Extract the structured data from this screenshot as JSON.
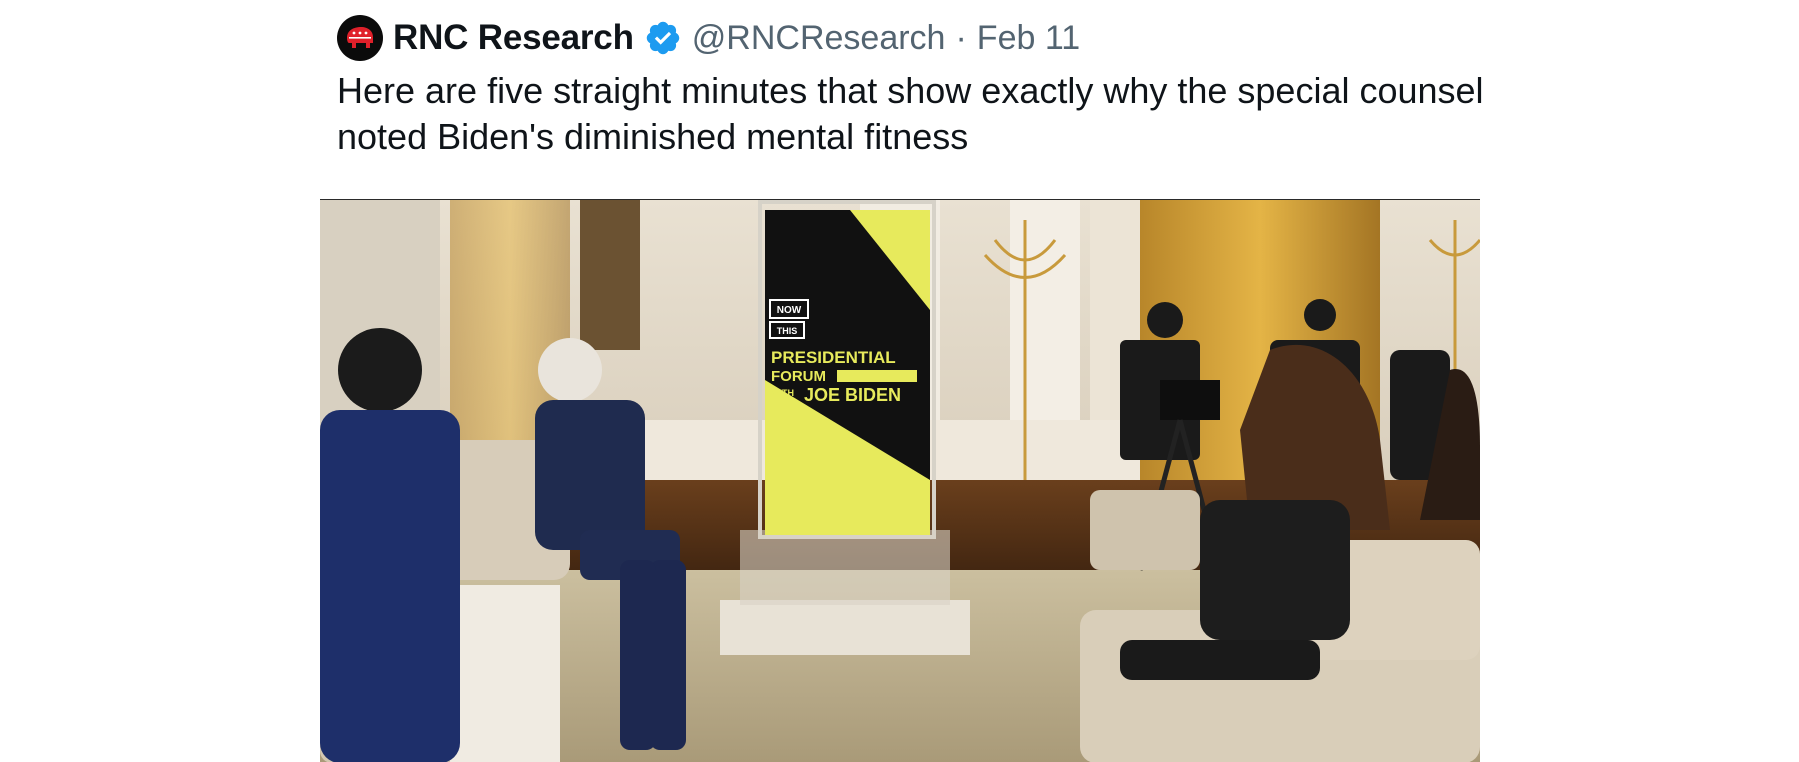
{
  "tweet": {
    "author_name": "RNC Research",
    "handle": "@RNCResearch",
    "separator": "·",
    "date": "Feb 11",
    "text": "Here are five straight minutes that show exactly why the special counsel noted Biden's diminished mental fitness",
    "avatar_icon": "elephant-icon",
    "verified_icon": "verified-badge-icon",
    "colors": {
      "verified": "#1d9bf0",
      "avatar_bg": "#0b0b0b",
      "elephant": "#e0202a",
      "text": "#0f1419",
      "muted": "#536471"
    }
  },
  "media": {
    "banner": {
      "line1": "NOW",
      "line2": "THIS",
      "line3": "PRESIDENTIAL",
      "line4": "FORUM",
      "line5": "WITH",
      "line6": "JOE BIDEN"
    }
  }
}
